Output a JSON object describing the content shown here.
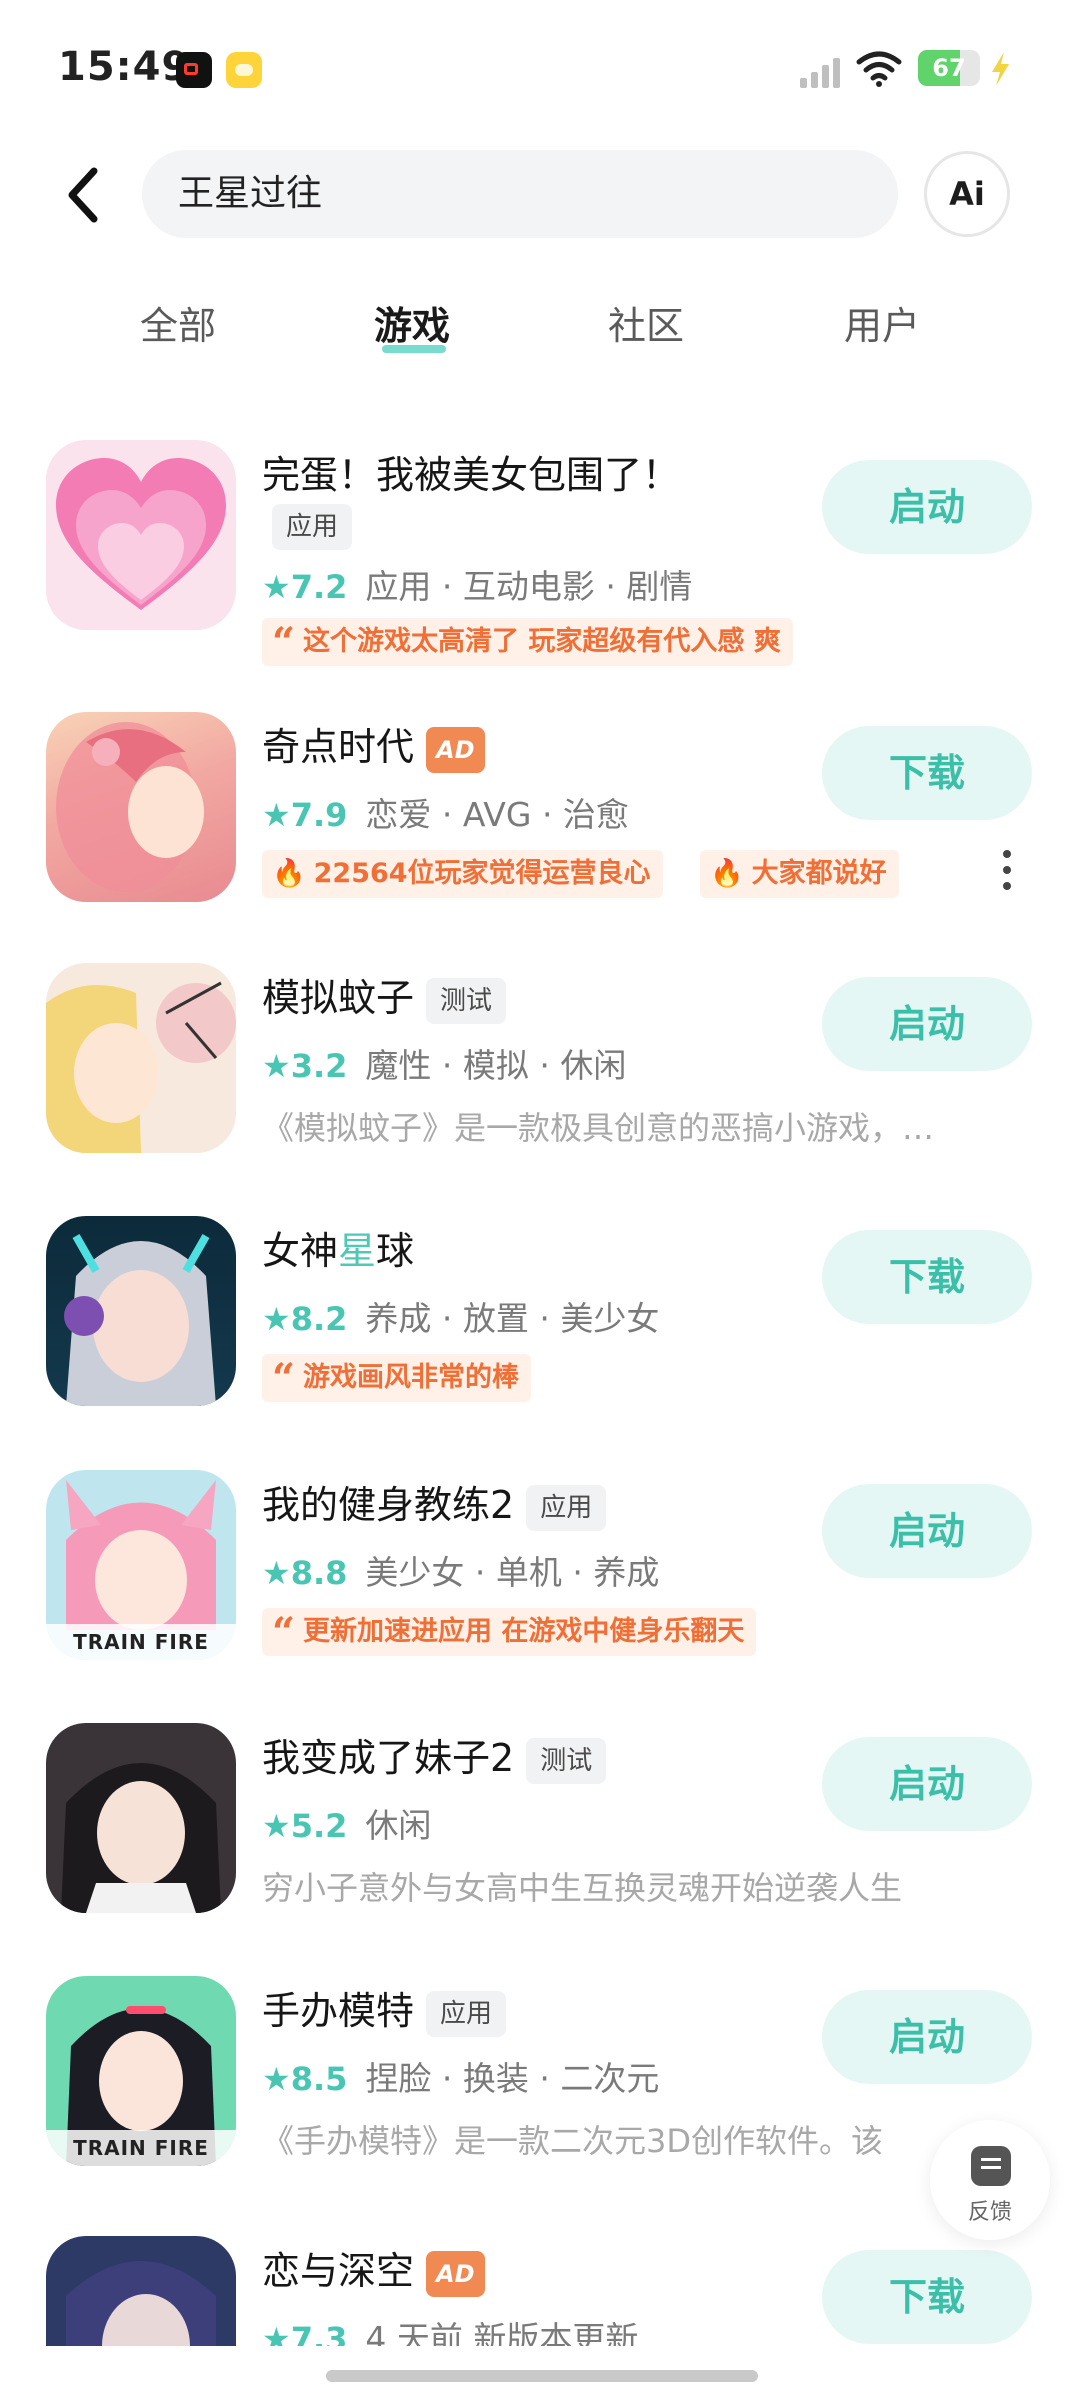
{
  "status_bar": {
    "time": "15:49",
    "battery": "67",
    "battery_level": 0.67
  },
  "search": {
    "query": "王星过往",
    "ai_label": "Ai"
  },
  "tabs": [
    {
      "label": "全部",
      "active": false
    },
    {
      "label": "游戏",
      "active": true
    },
    {
      "label": "社区",
      "active": false
    },
    {
      "label": "用户",
      "active": false
    }
  ],
  "items": [
    {
      "title": "完蛋！我被美女包围了！",
      "tag": "应用",
      "rating": "★7.2",
      "genres": "应用 · 互动电影 · 剧情",
      "hot": "这个游戏太高清了 玩家超级有代入感 爽",
      "button": "启动"
    },
    {
      "title": "奇点时代",
      "ad": "AD",
      "rating": "★7.9",
      "genres": "恋爱 · AVG · 治愈",
      "hot1": "22564位玩家觉得运营良心",
      "hot2": "大家都说好",
      "button": "下载"
    },
    {
      "title": "模拟蚊子",
      "tag": "测试",
      "rating": "★3.2",
      "genres": "魔性 · 模拟 · 休闲",
      "desc": "《模拟蚊子》是一款极具创意的恶搞小游戏，…",
      "button": "启动"
    },
    {
      "title_a": "女神",
      "title_b": "星",
      "title_c": "球",
      "rating": "★8.2",
      "genres": "养成 · 放置 · 美少女",
      "hot": "游戏画风非常的棒",
      "button": "下载"
    },
    {
      "title": "我的健身教练2",
      "tag": "应用",
      "rating": "★8.8",
      "genres": "美少女 · 单机 · 养成",
      "hot": "更新加速进应用 在游戏中健身乐翻天",
      "button": "启动",
      "icon_text": "TRAIN FIRE"
    },
    {
      "title": "我变成了妹子2",
      "tag": "测试",
      "rating": "★5.2",
      "genres": "休闲",
      "desc": "穷小子意外与女高中生互换灵魂开始逆袭人生",
      "button": "启动"
    },
    {
      "title": "手办模特",
      "tag": "应用",
      "rating": "★8.5",
      "genres": "捏脸 · 换装 · 二次元",
      "desc": "《手办模特》是一款二次元3D创作软件。该",
      "button": "启动",
      "icon_text": "TRAIN FIRE"
    },
    {
      "title": "恋与深空",
      "ad": "AD",
      "rating": "★7.3",
      "genres": "4 天前 新版本更新",
      "button": "下载"
    }
  ],
  "feedback": {
    "label": "反馈"
  },
  "colors": {
    "accent": "#49c6b3",
    "hot": "#ef6f36",
    "button_bg": "#e5f7f4"
  }
}
